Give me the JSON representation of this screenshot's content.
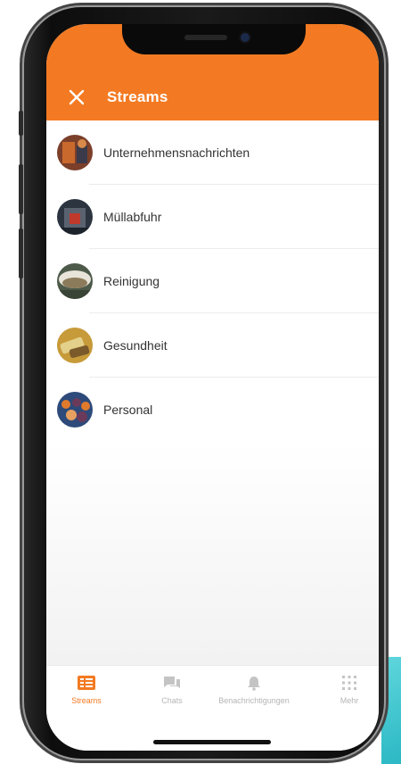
{
  "app": {
    "title": "Streams",
    "accent_color": "#f37a22",
    "close_icon": "close-icon"
  },
  "streams": [
    {
      "label": "Unternehmensnachrichten",
      "avatar": "news-avatar",
      "colors": [
        "#7b3f2a",
        "#c9692d",
        "#3a3a4a"
      ]
    },
    {
      "label": "Müllabfuhr",
      "avatar": "garbage-truck-avatar",
      "colors": [
        "#2c3440",
        "#c0392b",
        "#5a6270"
      ]
    },
    {
      "label": "Reinigung",
      "avatar": "cleaning-avatar",
      "colors": [
        "#4d5a4a",
        "#e8e4d9",
        "#8c7b5b"
      ]
    },
    {
      "label": "Gesundheit",
      "avatar": "health-avatar",
      "colors": [
        "#c79a3a",
        "#7a5a2a",
        "#e3d08a"
      ]
    },
    {
      "label": "Personal",
      "avatar": "team-avatar",
      "colors": [
        "#2d4a7a",
        "#e07a2c",
        "#6b3a5a"
      ]
    }
  ],
  "tabbar": {
    "tabs": [
      {
        "label": "Streams",
        "icon": "streams-icon",
        "active": true
      },
      {
        "label": "Chats",
        "icon": "chat-icon",
        "active": false
      },
      {
        "label": "Benachrichtigungen",
        "icon": "bell-icon",
        "active": false
      },
      {
        "label": "Mehr",
        "icon": "grid-icon",
        "active": false
      }
    ]
  }
}
